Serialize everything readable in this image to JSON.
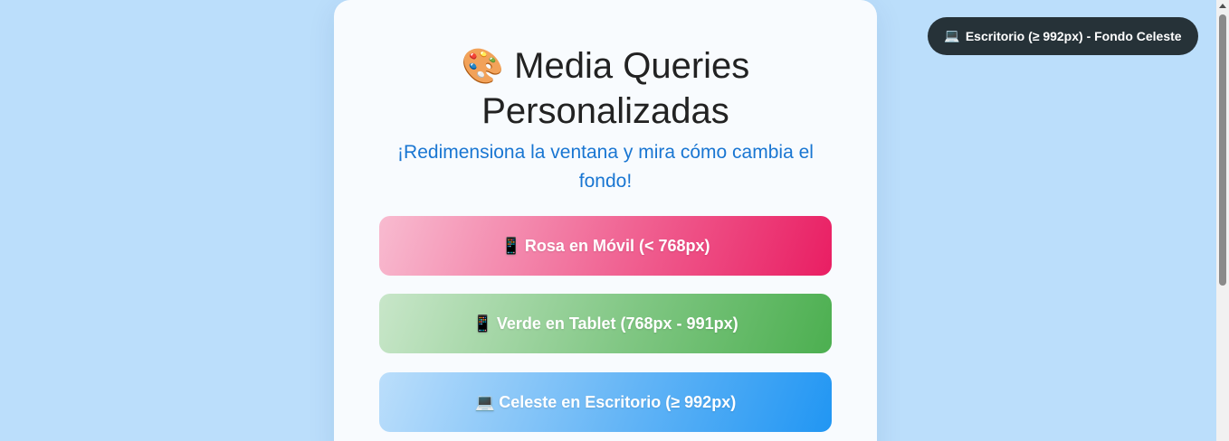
{
  "page": {
    "title_icon": "🎨",
    "title": "Media Queries Personalizadas",
    "subtitle": "¡Redimensiona la ventana y mira cómo cambia el fondo!"
  },
  "breakpoints": [
    {
      "icon": "📱",
      "icon_name": "mobile-phone-icon",
      "label": "Rosa en Móvil (< 768px)",
      "color": "#e91e63"
    },
    {
      "icon": "📱",
      "icon_name": "tablet-icon",
      "label": "Verde en Tablet (768px - 991px)",
      "color": "#4caf50"
    },
    {
      "icon": "💻",
      "icon_name": "laptop-icon",
      "label": "Celeste en Escritorio (≥ 992px)",
      "color": "#2196f3"
    }
  ],
  "indicator": {
    "icon": "💻",
    "icon_name": "laptop-icon",
    "label": "Escritorio (≥ 992px) - Fondo Celeste"
  },
  "colors": {
    "background": "#bbdefb",
    "card": "#f8fbfe",
    "subtitle": "#1976d2",
    "indicator_bg": "#263238"
  }
}
